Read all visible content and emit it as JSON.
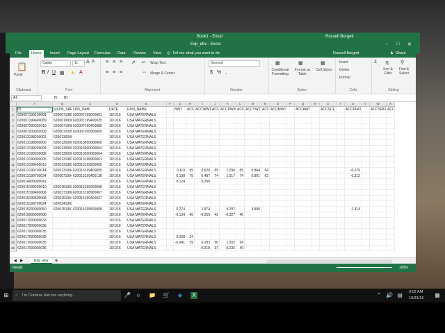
{
  "window": {
    "app_title": "Book1 - Excel",
    "doc_title": "Exp_ebv - Excel",
    "user": "Russell Burgett"
  },
  "menu": {
    "tabs": [
      "File",
      "Home",
      "Insert",
      "Page Layout",
      "Formulas",
      "Data",
      "Review",
      "View"
    ],
    "tell_me": "Tell me what you want to do",
    "user": "Russell Burgett",
    "share": "Share"
  },
  "ribbon": {
    "paste": "Paste",
    "clipboard": "Clipboard",
    "font_name": "Calibri",
    "font_size": "11",
    "font": "Font",
    "wrap": "Wrap Text",
    "merge": "Merge & Center",
    "alignment": "Alignment",
    "number_format": "General",
    "number": "Number",
    "cond": "Conditional Formatting",
    "fmt_table": "Format as Table",
    "cell_styles": "Cell Styles",
    "styles": "Styles",
    "insert": "Insert",
    "delete": "Delete",
    "format": "Format",
    "cells": "Cells",
    "sort": "Sort & Filter",
    "find": "Find & Select",
    "editing": "Editing"
  },
  "formula_bar": {
    "name_box": "A1",
    "fx": "fx",
    "content": "ID"
  },
  "columns": [
    "A",
    "B",
    "C",
    "D",
    "E",
    "F",
    "G",
    "H",
    "I",
    "J",
    "K",
    "L",
    "M",
    "N",
    "O",
    "P",
    "Q",
    "R",
    "S",
    "T",
    "U",
    "V",
    "W",
    "X"
  ],
  "rows": [
    {
      "n": "1",
      "c": [
        "ID",
        "SILPN_SRE",
        "LPN_DAM",
        "DATE",
        "RUN_NAME",
        "",
        "BWT",
        "ACC",
        "ACCWWT",
        "ACC",
        "ACCPWWT",
        "ACC",
        "ACCYWT",
        "ACC",
        "ACCMWT",
        "",
        "ACCAWT",
        "",
        "ACCSCF",
        "",
        "ACCPFAT",
        "",
        "ACCYFAT",
        "ACCH"
      ]
    },
    {
      "n": "2",
      "c": [
        "620007199100001",
        "620007198900026",
        "620007199000001",
        "10/1/16",
        "USA MATERNALS",
        "",
        "",
        "",
        "",
        "",
        "",
        "",
        "",
        "",
        "",
        "",
        "",
        "",
        "",
        "",
        "",
        "",
        "",
        ""
      ]
    },
    {
      "n": "3",
      "c": [
        "620007199400089",
        "620001993000005",
        "620007199400035",
        "10/1/16",
        "USA MATERNALS",
        "",
        "",
        "",
        "",
        "",
        "",
        "",
        "",
        "",
        "",
        "",
        "",
        "",
        "",
        "",
        "",
        "",
        "",
        ""
      ]
    },
    {
      "n": "4",
      "c": [
        "620007200302019",
        "620007199800012",
        "620007199400080",
        "10/1/16",
        "USA MATERNALS",
        "",
        "",
        "",
        "",
        "",
        "",
        "",
        "",
        "",
        "",
        "",
        "",
        "",
        "",
        "",
        "",
        "",
        "",
        ""
      ]
    },
    {
      "n": "5",
      "c": [
        "620007200902009",
        "620007200500051",
        "620007200500005",
        "10/1/16",
        "USA MATERNALS",
        "",
        "",
        "",
        "",
        "",
        "",
        "",
        "",
        "",
        "",
        "",
        "",
        "",
        "",
        "",
        "",
        "",
        "",
        ""
      ]
    },
    {
      "n": "6",
      "c": [
        "620013198200002",
        "620013000050021",
        "",
        "10/1/16",
        "USA MATERNALS",
        "",
        "",
        "",
        "",
        "",
        "",
        "",
        "",
        "",
        "",
        "",
        "",
        "",
        "",
        "",
        "",
        "",
        "",
        ""
      ]
    },
    {
      "n": "7",
      "c": [
        "620013198900000",
        "620013000000000",
        "620013000000000",
        "10/1/16",
        "USA MATERNALS",
        "",
        "",
        "",
        "",
        "",
        "",
        "",
        "",
        "",
        "",
        "",
        "",
        "",
        "",
        "",
        "",
        "",
        "",
        ""
      ]
    },
    {
      "n": "8",
      "c": [
        "620013199200004",
        "620013000000004",
        "620013000000004",
        "10/1/16",
        "USA MATERNALS",
        "",
        "",
        "",
        "",
        "",
        "",
        "",
        "",
        "",
        "",
        "",
        "",
        "",
        "",
        "",
        "",
        "",
        "",
        ""
      ]
    },
    {
      "n": "9",
      "c": [
        "620013199200009",
        "620013000000004",
        "620013000000004",
        "10/1/16",
        "USA MATERNALS",
        "",
        "",
        "",
        "",
        "",
        "",
        "",
        "",
        "",
        "",
        "",
        "",
        "",
        "",
        "",
        "",
        "",
        "",
        ""
      ]
    },
    {
      "n": "10",
      "c": [
        "620013199300005",
        "620013198200021",
        "620013198900001",
        "10/1/16",
        "USA MATERNALS",
        "",
        "",
        "",
        "",
        "",
        "",
        "",
        "",
        "",
        "",
        "",
        "",
        "",
        "",
        "",
        "",
        "",
        "",
        ""
      ]
    },
    {
      "n": "11",
      "c": [
        "620013199400013",
        "620013198200002",
        "620013199200009",
        "10/1/16",
        "USA MATERNALS",
        "",
        "",
        "",
        "",
        "",
        "",
        "",
        "",
        "",
        "",
        "",
        "",
        "",
        "",
        "",
        "",
        "",
        "",
        ""
      ]
    },
    {
      "n": "12",
      "c": [
        "620013199700014",
        "620013199400000",
        "620013199400055",
        "10/1/16",
        "USA MATERNALS",
        "",
        "0.110",
        "65",
        "0.620",
        "65",
        "1.290",
        "65",
        "0.864",
        "54",
        "",
        "",
        "",
        "",
        "",
        "",
        "-0.270",
        "",
        "",
        ""
      ]
    },
    {
      "n": "13",
      "c": [
        "620013199700034",
        "620007199400089",
        "620013199400138",
        "10/1/16",
        "USA MATERNALS",
        "",
        "0.108",
        "75",
        "0.487",
        "74",
        "1.017",
        "74",
        "0.801",
        "62",
        "",
        "",
        "",
        "",
        "",
        "",
        "-0.312",
        "",
        "",
        ""
      ]
    },
    {
      "n": "14",
      "c": [
        "620014000000041",
        "",
        "",
        "10/1/16",
        "USA MATERNALS",
        "",
        "0.124",
        "",
        "0.260",
        "",
        "",
        "",
        "",
        "",
        "",
        "",
        "",
        "",
        "",
        "",
        "",
        "",
        "",
        ""
      ]
    },
    {
      "n": "15",
      "c": [
        "620015199200010",
        "620015199200013",
        "620015199200008",
        "10/1/16",
        "USA MATERNALS",
        "",
        "",
        "",
        "",
        "",
        "",
        "",
        "",
        "",
        "",
        "",
        "",
        "",
        "",
        "",
        "",
        "",
        "",
        ""
      ]
    },
    {
      "n": "16",
      "c": [
        "620015199400006",
        "620017198800040",
        "620015198900067",
        "10/1/16",
        "USA MATERNALS",
        "",
        "",
        "",
        "",
        "",
        "",
        "",
        "",
        "",
        "",
        "",
        "",
        "",
        "",
        "",
        "",
        "",
        "",
        ""
      ]
    },
    {
      "n": "17",
      "c": [
        "620015199500008",
        "620015199400066",
        "620015199400027",
        "10/1/16",
        "USA MATERNALS",
        "",
        "",
        "",
        "",
        "",
        "",
        "",
        "",
        "",
        "",
        "",
        "",
        "",
        "",
        "",
        "",
        "",
        "",
        ""
      ]
    },
    {
      "n": "18",
      "c": [
        "620015199700024",
        "620024199200102",
        "",
        "10/1/16",
        "USA MATERNALS",
        "",
        "",
        "",
        "",
        "",
        "",
        "",
        "",
        "",
        "",
        "",
        "",
        "",
        "",
        "",
        "",
        "",
        "",
        ""
      ]
    },
    {
      "n": "19",
      "c": [
        "620015200000050",
        "620015199700024",
        "620015199500008",
        "10/1/16",
        "USA MATERNALS",
        "",
        "0.274",
        "",
        "1.974",
        "",
        "5.297",
        "",
        "4.895",
        "",
        "",
        "",
        "",
        "",
        "",
        "",
        "-1.314",
        "",
        "",
        ""
      ]
    },
    {
      "n": "20",
      "c": [
        "620016000000008",
        "",
        "",
        "10/1/16",
        "USA MATERNALS",
        "",
        "-0.134",
        "45",
        "-0.259",
        "42",
        "-0.327",
        "40",
        "",
        "",
        "",
        "",
        "",
        "",
        "",
        "",
        "",
        "",
        "",
        ""
      ]
    },
    {
      "n": "21",
      "c": [
        "620017000000033",
        "",
        "",
        "10/1/16",
        "USA MATERNALS",
        "",
        "",
        "",
        "",
        "",
        "",
        "",
        "",
        "",
        "",
        "",
        "",
        "",
        "",
        "",
        "",
        "",
        "",
        ""
      ]
    },
    {
      "n": "22",
      "c": [
        "620017000000035",
        "",
        "",
        "10/1/16",
        "USA MATERNALS",
        "",
        "",
        "",
        "",
        "",
        "",
        "",
        "",
        "",
        "",
        "",
        "",
        "",
        "",
        "",
        "",
        "",
        "",
        ""
      ]
    },
    {
      "n": "23",
      "c": [
        "620017000000035",
        "",
        "",
        "10/1/16",
        "USA MATERNALS",
        "",
        "",
        "",
        "",
        "",
        "",
        "",
        "",
        "",
        "",
        "",
        "",
        "",
        "",
        "",
        "",
        "",
        "",
        ""
      ]
    },
    {
      "n": "24",
      "c": [
        "620017000000035",
        "",
        "",
        "10/1/16",
        "USA MATERNALS",
        "",
        "0.028",
        "34",
        "",
        "",
        "",
        "",
        "",
        "",
        "",
        "",
        "",
        "",
        "",
        "",
        "",
        "",
        "",
        ""
      ]
    },
    {
      "n": "25",
      "c": [
        "620017000000035",
        "",
        "",
        "10/1/16",
        "USA MATERNALS",
        "",
        "-0.041",
        "39",
        "0.293",
        "50",
        "1.202",
        "54",
        "",
        "",
        "",
        "",
        "",
        "",
        "",
        "",
        "",
        "",
        "",
        ""
      ]
    },
    {
      "n": "26",
      "c": [
        "620017000000035",
        "",
        "",
        "10/1/16",
        "USA MATERNALS",
        "",
        "",
        "",
        "-0.218",
        "37",
        "-0.236",
        "40",
        "",
        "",
        "",
        "",
        "",
        "",
        "",
        "",
        "",
        "",
        "",
        ""
      ]
    }
  ],
  "sheet": {
    "tab": "Exp_ebv"
  },
  "status": {
    "ready": "Ready",
    "zoom": "100%"
  },
  "taskbar": {
    "search": "I'm Cortana. Ask me anything.",
    "time": "9:02 AM",
    "date": "10/31/16"
  }
}
